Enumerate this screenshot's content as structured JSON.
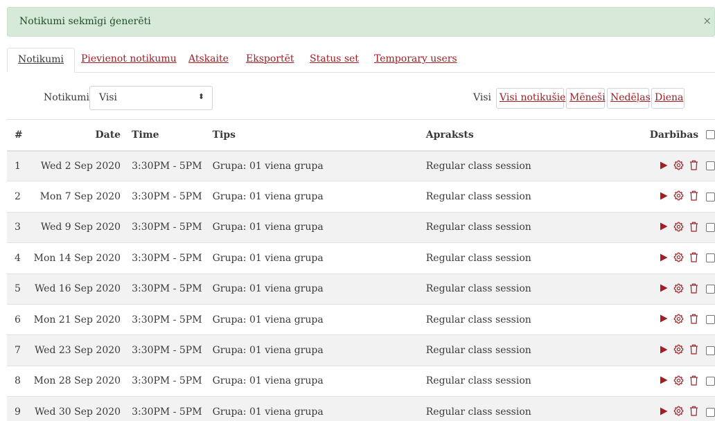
{
  "alert": {
    "message": "Notikumi sekmīgi ģenerēti",
    "close_symbol": "×"
  },
  "tabs": [
    {
      "label": "Notikumi",
      "active": true
    },
    {
      "label": "Pievienot notikumu",
      "active": false
    },
    {
      "label": "Atskaite",
      "active": false
    },
    {
      "label": "Eksportēt",
      "active": false
    },
    {
      "label": "Status set",
      "active": false
    },
    {
      "label": "Temporary users",
      "active": false
    }
  ],
  "filter": {
    "label": "Notikumi",
    "selected": "Visi"
  },
  "view": {
    "label": "Visi",
    "buttons": [
      "Visi notikušie",
      "Mēneši",
      "Nedēļas",
      "Diena"
    ]
  },
  "table": {
    "headers": {
      "num": "#",
      "date": "Date",
      "time": "Time",
      "type": "Tips",
      "desc": "Apraksts",
      "actions": "Darbības"
    },
    "rows": [
      {
        "num": "1",
        "date": "Wed 2 Sep 2020",
        "time": "3:30PM - 5PM",
        "type": "Grupa: 01 viena grupa",
        "desc": "Regular class session"
      },
      {
        "num": "2",
        "date": "Mon 7 Sep 2020",
        "time": "3:30PM - 5PM",
        "type": "Grupa: 01 viena grupa",
        "desc": "Regular class session"
      },
      {
        "num": "3",
        "date": "Wed 9 Sep 2020",
        "time": "3:30PM - 5PM",
        "type": "Grupa: 01 viena grupa",
        "desc": "Regular class session"
      },
      {
        "num": "4",
        "date": "Mon 14 Sep 2020",
        "time": "3:30PM - 5PM",
        "type": "Grupa: 01 viena grupa",
        "desc": "Regular class session"
      },
      {
        "num": "5",
        "date": "Wed 16 Sep 2020",
        "time": "3:30PM - 5PM",
        "type": "Grupa: 01 viena grupa",
        "desc": "Regular class session"
      },
      {
        "num": "6",
        "date": "Mon 21 Sep 2020",
        "time": "3:30PM - 5PM",
        "type": "Grupa: 01 viena grupa",
        "desc": "Regular class session"
      },
      {
        "num": "7",
        "date": "Wed 23 Sep 2020",
        "time": "3:30PM - 5PM",
        "type": "Grupa: 01 viena grupa",
        "desc": "Regular class session"
      },
      {
        "num": "8",
        "date": "Mon 28 Sep 2020",
        "time": "3:30PM - 5PM",
        "type": "Grupa: 01 viena grupa",
        "desc": "Regular class session"
      },
      {
        "num": "9",
        "date": "Wed 30 Sep 2020",
        "time": "3:30PM - 5PM",
        "type": "Grupa: 01 viena grupa",
        "desc": "Regular class session"
      }
    ],
    "row_actions": [
      "play-icon",
      "gear-icon",
      "trash-icon"
    ]
  },
  "colors": {
    "accent": "#a01e24",
    "alert_bg": "#d7ead9",
    "alert_text": "#1d4d26",
    "stripe": "#f2f2f2"
  }
}
